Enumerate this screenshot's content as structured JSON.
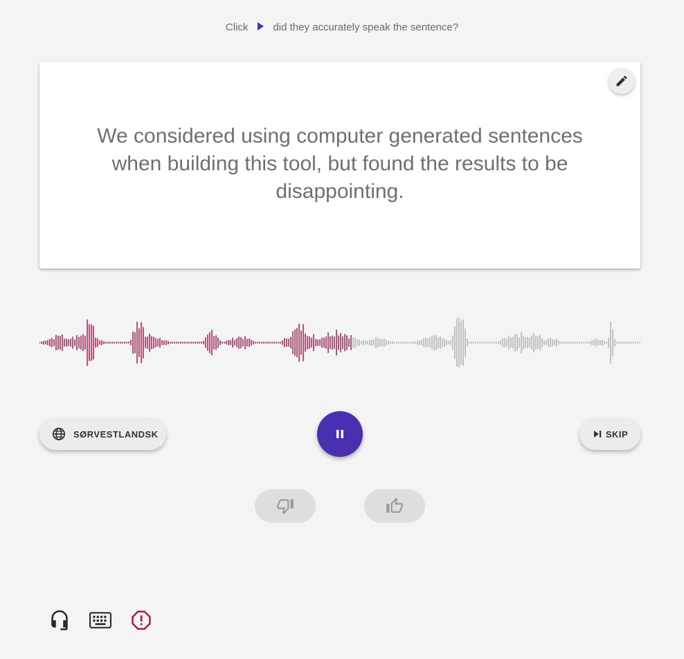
{
  "instruction": {
    "prefix": "Click",
    "suffix": "did they accurately speak the sentence?"
  },
  "sentence": {
    "text": "We considered using computer generated sentences when building this tool, but found the results to be disappointing."
  },
  "controls": {
    "dialect_label": "SØRVESTLANDSK",
    "skip_label": "SKIP"
  },
  "playback": {
    "state": "playing",
    "progress": 0.52
  },
  "colors": {
    "accent": "#4a2fb0",
    "played": "#b0426a",
    "unplayed": "#bdbdbd",
    "report": "#b5173f"
  },
  "icons": {
    "edit": "pencil-icon",
    "dialect": "globe-icon",
    "skip": "skip-next-icon",
    "pause": "pause-icon",
    "vote_no": "thumb-down-icon",
    "vote_yes": "thumb-up-icon",
    "shortcuts": "headset-icon",
    "keyboard": "keyboard-icon",
    "report": "report-icon"
  }
}
